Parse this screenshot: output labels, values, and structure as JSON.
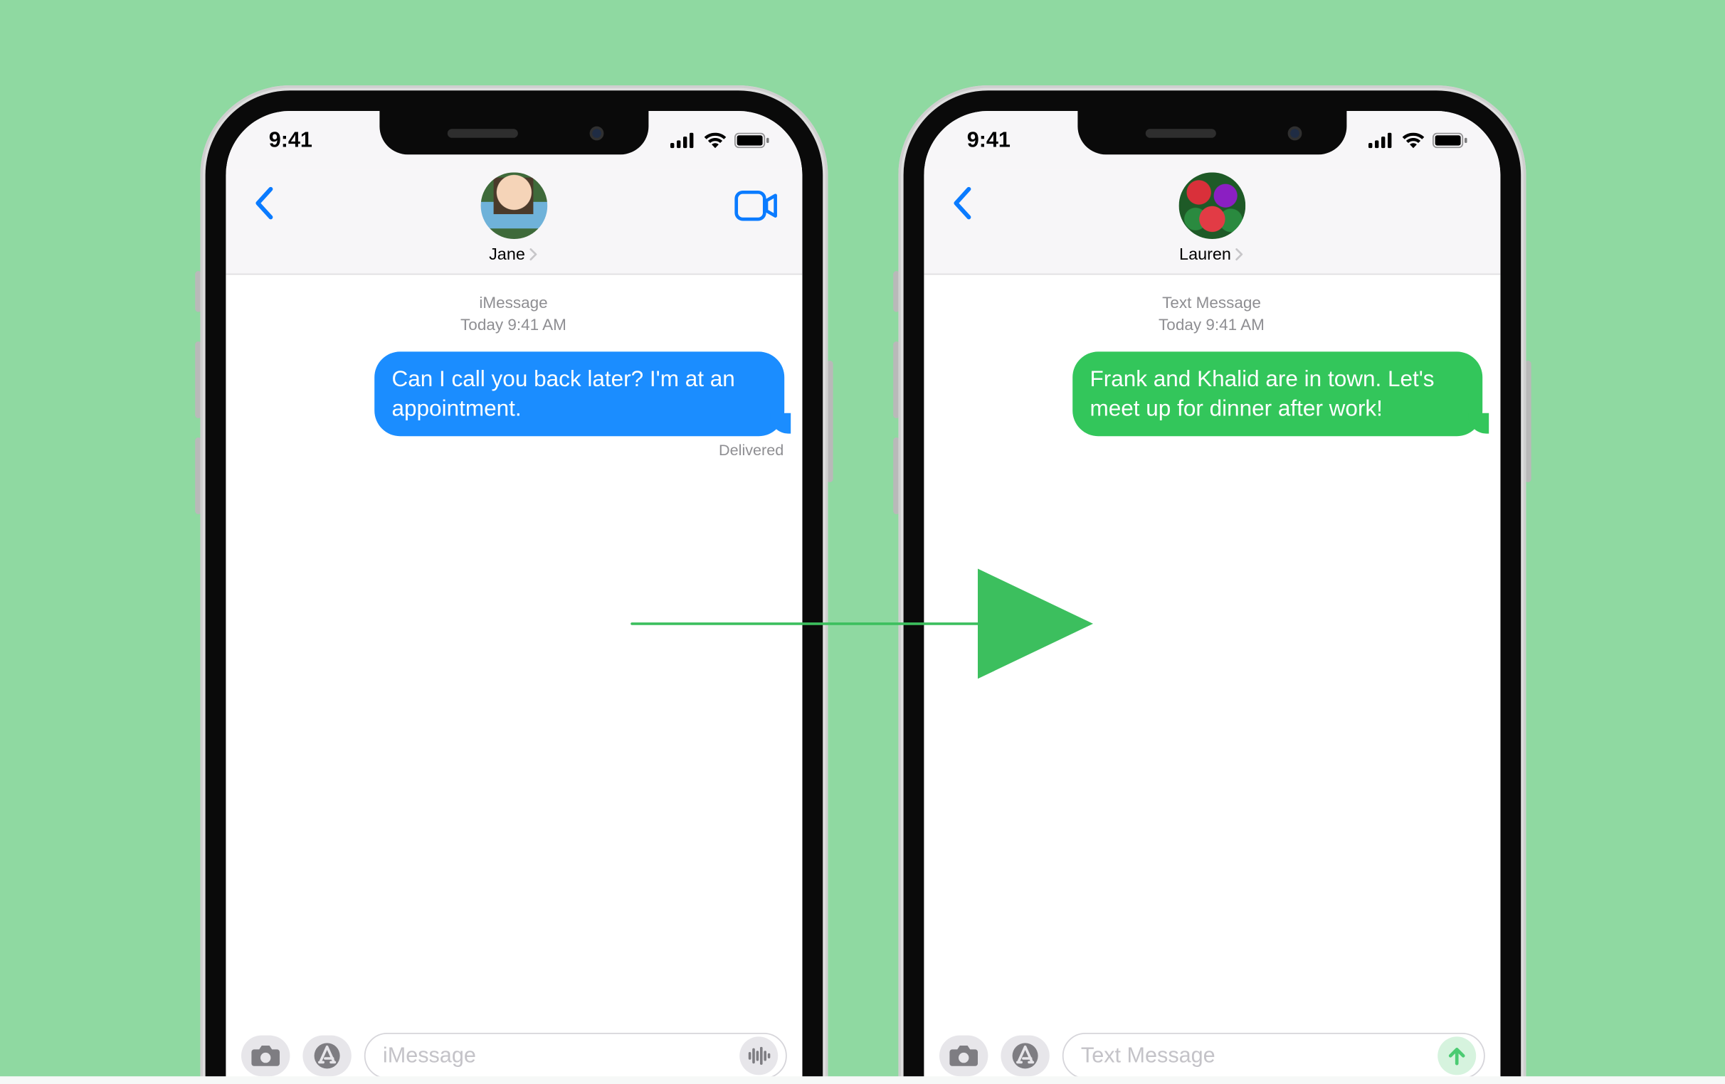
{
  "status_time": "9:41",
  "left": {
    "contact": "Jane",
    "meta_type": "iMessage",
    "meta_time_prefix": "Today",
    "meta_time": "9:41 AM",
    "message": "Can I call you back later? I'm at an appointment.",
    "delivered": "Delivered",
    "input_placeholder": "iMessage"
  },
  "right": {
    "contact": "Lauren",
    "meta_type": "Text Message",
    "meta_time_prefix": "Today",
    "meta_time": "9:41 AM",
    "message": "Frank and Khalid are in town. Let's meet up for dinner after work!",
    "input_placeholder": "Text Message"
  }
}
